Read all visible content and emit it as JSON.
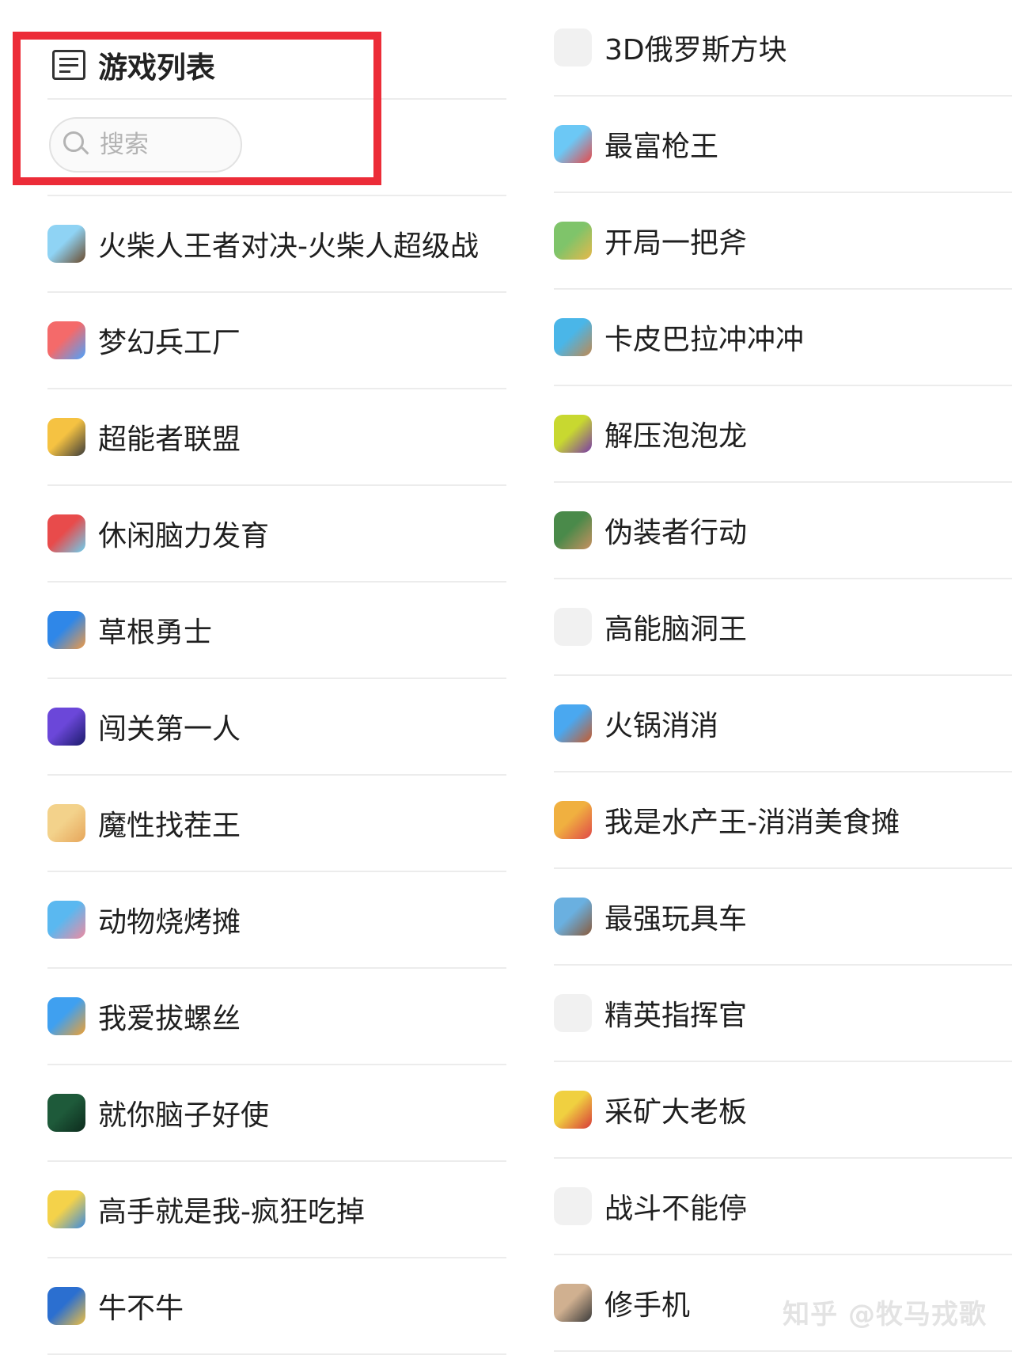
{
  "header": {
    "title": "游戏列表",
    "icon": "list-icon"
  },
  "search": {
    "placeholder": "搜索",
    "icon": "search-icon"
  },
  "left_games": [
    {
      "label": "火柴人王者对决-火柴人超级战",
      "icon": "stickman-game-icon",
      "colors": [
        "#8fd3f4",
        "#6b4a2b"
      ]
    },
    {
      "label": "梦幻兵工厂",
      "icon": "arsenal-game-icon",
      "colors": [
        "#f46a6a",
        "#4aa3ff"
      ]
    },
    {
      "label": "超能者联盟",
      "icon": "superhero-game-icon",
      "colors": [
        "#f5c242",
        "#3b3b3b"
      ]
    },
    {
      "label": "休闲脑力发育",
      "icon": "brain-game-icon",
      "colors": [
        "#e84b4b",
        "#6ad0f0"
      ]
    },
    {
      "label": "草根勇士",
      "icon": "warrior-game-icon",
      "colors": [
        "#2f87e8",
        "#f19a44"
      ]
    },
    {
      "label": "闯关第一人",
      "icon": "level-game-icon",
      "colors": [
        "#6b47d9",
        "#1b1b6b"
      ]
    },
    {
      "label": "魔性找茬王",
      "icon": "spot-difference-game-icon",
      "colors": [
        "#f3d28b",
        "#e6a55a"
      ]
    },
    {
      "label": "动物烧烤摊",
      "icon": "animal-bbq-game-icon",
      "colors": [
        "#5ab8f0",
        "#f08aa0"
      ]
    },
    {
      "label": "我爱拔螺丝",
      "icon": "screw-game-icon",
      "colors": [
        "#3fa0f0",
        "#f0a030"
      ]
    },
    {
      "label": "就你脑子好使",
      "icon": "smart-brain-game-icon",
      "colors": [
        "#1e5a3a",
        "#0d2b1d"
      ]
    },
    {
      "label": "高手就是我-疯狂吃掉",
      "icon": "eat-game-icon",
      "colors": [
        "#f4d24a",
        "#3a8ae0"
      ]
    },
    {
      "label": "牛不牛",
      "icon": "bull-game-icon",
      "colors": [
        "#2b6fd0",
        "#f0c040"
      ]
    }
  ],
  "right_games": [
    {
      "label": "3D俄罗斯方块",
      "icon": "tetris-game-icon",
      "colors": []
    },
    {
      "label": "最富枪王",
      "icon": "gun-king-game-icon",
      "colors": [
        "#6cc8f5",
        "#e84848"
      ]
    },
    {
      "label": "开局一把斧",
      "icon": "axe-game-icon",
      "colors": [
        "#7fc46a",
        "#e8b84a"
      ]
    },
    {
      "label": "卡皮巴拉冲冲冲",
      "icon": "capybara-game-icon",
      "colors": [
        "#4ab6e8",
        "#c08850"
      ]
    },
    {
      "label": "解压泡泡龙",
      "icon": "bubble-game-icon",
      "colors": [
        "#c8d830",
        "#7a3aa8"
      ]
    },
    {
      "label": "伪装者行动",
      "icon": "disguise-game-icon",
      "colors": [
        "#4a8a4a",
        "#c89060"
      ]
    },
    {
      "label": "高能脑洞王",
      "icon": "brain-hole-game-icon",
      "colors": []
    },
    {
      "label": "火锅消消",
      "icon": "hotpot-game-icon",
      "colors": [
        "#4aa8f0",
        "#c85a2a"
      ]
    },
    {
      "label": "我是水产王-消消美食摊",
      "icon": "seafood-game-icon",
      "colors": [
        "#f0b040",
        "#e04848"
      ]
    },
    {
      "label": "最强玩具车",
      "icon": "toy-car-game-icon",
      "colors": [
        "#6ab0e0",
        "#8a5a3a"
      ]
    },
    {
      "label": "精英指挥官",
      "icon": "commander-game-icon",
      "colors": []
    },
    {
      "label": "采矿大老板",
      "icon": "mining-game-icon",
      "colors": [
        "#f0d040",
        "#d83a3a"
      ]
    },
    {
      "label": "战斗不能停",
      "icon": "battle-game-icon",
      "colors": []
    },
    {
      "label": "修手机",
      "icon": "phone-repair-game-icon",
      "colors": [
        "#d0b090",
        "#3a3a3a"
      ]
    }
  ],
  "watermark": "知乎 @牧马戎歌",
  "colors": {
    "highlight_frame": "#ec2c38",
    "divider": "#ececec",
    "text": "#1f1f1f"
  }
}
